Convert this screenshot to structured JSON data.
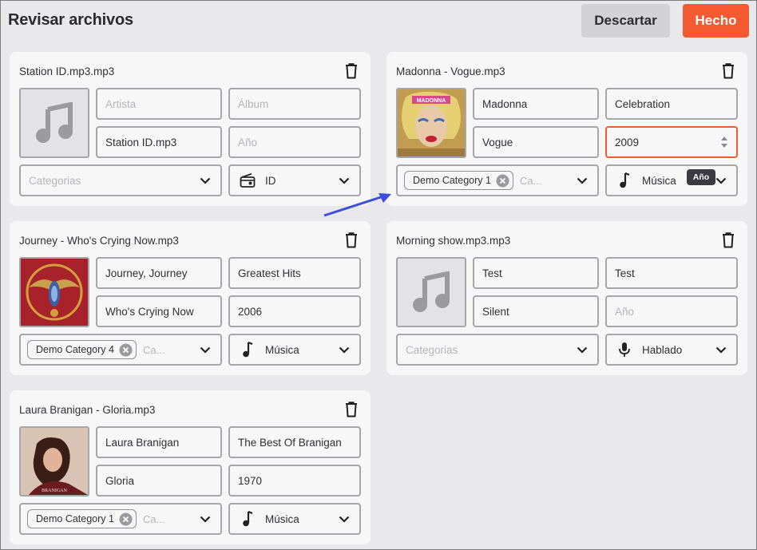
{
  "header": {
    "title": "Revisar archivos",
    "discard_label": "Descartar",
    "done_label": "Hecho"
  },
  "colors": {
    "accent": "#f45a32",
    "background": "#e9e8ea",
    "card": "#f7f7f8",
    "annotation_arrow": "#3d4fd8"
  },
  "placeholders": {
    "artist": "Artista",
    "album": "Álbum",
    "year": "Año",
    "categories": "Categorias",
    "categories_short": "Ca..."
  },
  "tooltip": "Año",
  "cards": [
    {
      "filename": "Station ID.mp3.mp3",
      "artist": "",
      "album": "",
      "title": "Station ID.mp3",
      "year": "",
      "category": "",
      "type": "ID",
      "type_icon": "radio-icon"
    },
    {
      "filename": "Madonna - Vogue.mp3",
      "artist": "Madonna",
      "album": "Celebration",
      "title": "Vogue",
      "year": "2009",
      "category": "Demo Category 1",
      "type": "Música",
      "type_icon": "music-note-icon"
    },
    {
      "filename": "Journey - Who's Crying Now.mp3",
      "artist": "Journey, Journey",
      "album": "Greatest Hits",
      "title": "Who's Crying Now",
      "year": "2006",
      "category": "Demo Category 4",
      "type": "Música",
      "type_icon": "music-note-icon"
    },
    {
      "filename": "Morning show.mp3.mp3",
      "artist": "Test",
      "album": "Test",
      "title": "Silent",
      "year": "",
      "category": "",
      "type": "Hablado",
      "type_icon": "microphone-icon"
    },
    {
      "filename": "Laura Branigan - Gloria.mp3",
      "artist": "Laura Branigan",
      "album": "The Best Of Branigan",
      "title": "Gloria",
      "year": "1970",
      "category": "Demo Category 1",
      "type": "Música",
      "type_icon": "music-note-icon"
    }
  ]
}
